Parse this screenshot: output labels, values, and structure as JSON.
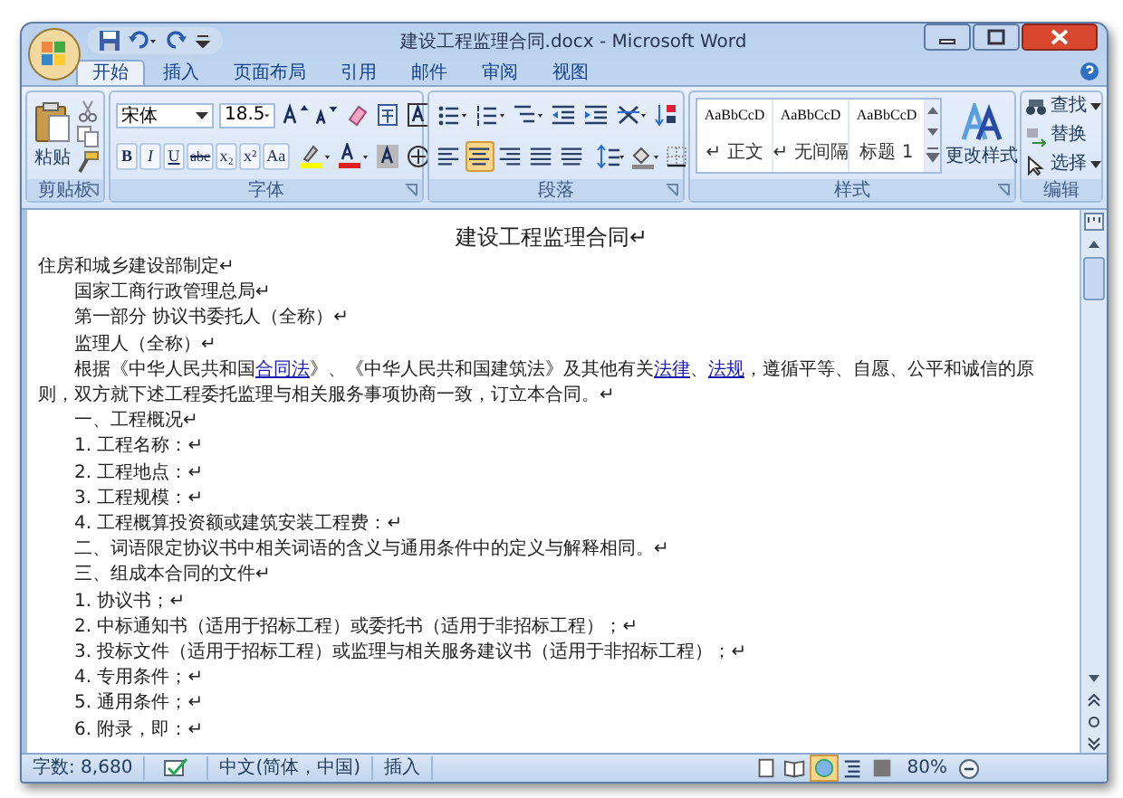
{
  "window": {
    "title": "建设工程监理合同.docx - Microsoft Word"
  },
  "tabs": [
    {
      "label": "开始",
      "selected": true
    },
    {
      "label": "插入",
      "selected": false
    },
    {
      "label": "页面布局",
      "selected": false
    },
    {
      "label": "引用",
      "selected": false
    },
    {
      "label": "邮件",
      "selected": false
    },
    {
      "label": "审阅",
      "selected": false
    },
    {
      "label": "视图",
      "selected": false
    }
  ],
  "clipboard": {
    "label": "剪贴板",
    "paste": "粘贴"
  },
  "font": {
    "label": "字体",
    "family": "宋体",
    "size": "18.5",
    "format_buttons": [
      {
        "kind": "bold",
        "label": "B"
      },
      {
        "kind": "italic",
        "label": "I"
      },
      {
        "kind": "underline",
        "label": "U"
      },
      {
        "kind": "strike",
        "label": "abc"
      },
      {
        "kind": "sub",
        "label": "x₂"
      },
      {
        "kind": "sup",
        "label": "x²"
      },
      {
        "kind": "case",
        "label": "Aa"
      }
    ]
  },
  "paragraph": {
    "label": "段落",
    "alignment": [
      {
        "kind": "left",
        "selected": false
      },
      {
        "kind": "center",
        "selected": true
      },
      {
        "kind": "right",
        "selected": false
      },
      {
        "kind": "justify",
        "selected": false
      },
      {
        "kind": "distributed",
        "selected": false
      }
    ]
  },
  "styles": {
    "label": "样式",
    "gallery": [
      {
        "preview": "AaBbCcD",
        "name": "↵ 正文"
      },
      {
        "preview": "AaBbCcD",
        "name": "↵ 无间隔"
      },
      {
        "preview": "AaBbCcD",
        "name": "标题 1"
      }
    ],
    "change": "更改样式"
  },
  "editing": {
    "label": "编辑",
    "find": "查找",
    "replace": "替换",
    "select": "选择"
  },
  "document": {
    "title": "建设工程监理合同↵",
    "paragraphs": [
      {
        "kind": "flush",
        "parts": [
          {
            "text": "住房和城乡建设部制定↵",
            "link": false
          }
        ]
      },
      {
        "kind": "indent",
        "parts": [
          {
            "text": "国家工商行政管理总局↵",
            "link": false
          }
        ]
      },
      {
        "kind": "indent",
        "parts": [
          {
            "text": "第一部分  协议书委托人（全称）↵",
            "link": false
          }
        ]
      },
      {
        "kind": "indent",
        "parts": [
          {
            "text": "监理人（全称）↵",
            "link": false
          }
        ]
      },
      {
        "kind": "first-line",
        "parts": [
          {
            "text": "根据《中华人民共和国",
            "link": false
          },
          {
            "text": "合同法",
            "link": true
          },
          {
            "text": "》、《中华人民共和国建筑法》及其他有关",
            "link": false
          },
          {
            "text": "法律",
            "link": true
          },
          {
            "text": "、",
            "link": false
          },
          {
            "text": "法规",
            "link": true
          },
          {
            "text": "，遵循平等、自愿、公平和诚信的原则，双方就下述工程委托监理与相关服务事项协商一致，订立本合同。↵",
            "link": false
          }
        ]
      },
      {
        "kind": "indent",
        "parts": [
          {
            "text": "一、工程概况↵",
            "link": false
          }
        ]
      },
      {
        "kind": "indent",
        "parts": [
          {
            "text": "1. 工程名称：↵",
            "link": false
          }
        ]
      },
      {
        "kind": "indent",
        "parts": [
          {
            "text": "2. 工程地点：↵",
            "link": false
          }
        ]
      },
      {
        "kind": "indent",
        "parts": [
          {
            "text": "3. 工程规模：↵",
            "link": false
          }
        ]
      },
      {
        "kind": "indent",
        "parts": [
          {
            "text": "4. 工程概算投资额或建筑安装工程费：↵",
            "link": false
          }
        ]
      },
      {
        "kind": "indent",
        "parts": [
          {
            "text": "二、词语限定协议书中相关词语的含义与通用条件中的定义与解释相同。↵",
            "link": false
          }
        ]
      },
      {
        "kind": "indent",
        "parts": [
          {
            "text": "三、组成本合同的文件↵",
            "link": false
          }
        ]
      },
      {
        "kind": "indent",
        "parts": [
          {
            "text": "1. 协议书；↵",
            "link": false
          }
        ]
      },
      {
        "kind": "indent",
        "parts": [
          {
            "text": "2. 中标通知书（适用于招标工程）或委托书（适用于非招标工程）；↵",
            "link": false
          }
        ]
      },
      {
        "kind": "indent",
        "parts": [
          {
            "text": "3. 投标文件（适用于招标工程）或监理与相关服务建议书（适用于非招标工程）；↵",
            "link": false
          }
        ]
      },
      {
        "kind": "indent",
        "parts": [
          {
            "text": "4. 专用条件；↵",
            "link": false
          }
        ]
      },
      {
        "kind": "indent",
        "parts": [
          {
            "text": "5. 通用条件；↵",
            "link": false
          }
        ]
      },
      {
        "kind": "indent",
        "parts": [
          {
            "text": "6. 附录，即：↵",
            "link": false
          }
        ]
      }
    ]
  },
  "status_bar": {
    "word_count": "字数: 8,680",
    "language": "中文(简体，中国)",
    "mode": "插入",
    "zoom": "80%",
    "views": [
      {
        "kind": "print",
        "selected": false
      },
      {
        "kind": "reading",
        "selected": false
      },
      {
        "kind": "web",
        "selected": true
      },
      {
        "kind": "outline",
        "selected": false
      },
      {
        "kind": "draft",
        "selected": false
      }
    ]
  }
}
